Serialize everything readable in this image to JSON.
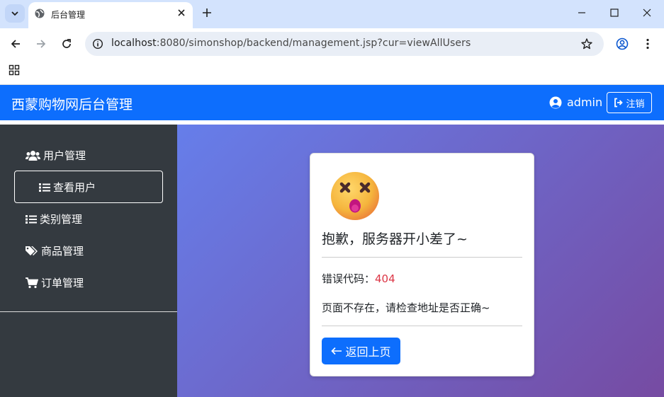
{
  "browser": {
    "tab_title": "后台管理",
    "url_host": "localhost",
    "url_rest": ":8080/simonshop/backend/management.jsp?cur=viewAllUsers"
  },
  "header": {
    "brand": "西蒙购物网后台管理",
    "username": "admin",
    "logout_label": "注销"
  },
  "sidebar": {
    "items": [
      {
        "label": "用户管理",
        "icon": "users-icon"
      },
      {
        "label": "查看用户",
        "icon": "list-icon"
      },
      {
        "label": "类别管理",
        "icon": "list-icon"
      },
      {
        "label": "商品管理",
        "icon": "tags-icon"
      },
      {
        "label": "订单管理",
        "icon": "cart-icon"
      }
    ]
  },
  "error": {
    "emoji": "😵",
    "title": "抱歉，服务器开小差了~",
    "code_label": "错误代码：",
    "code": "404",
    "message": "页面不存在，请检查地址是否正确~",
    "back_label": "返回上页"
  },
  "colors": {
    "primary": "#0d6efd",
    "sidebar": "#343a40",
    "gradient_start": "#667eea",
    "gradient_end": "#764ba2",
    "error_code": "#dc3545"
  }
}
